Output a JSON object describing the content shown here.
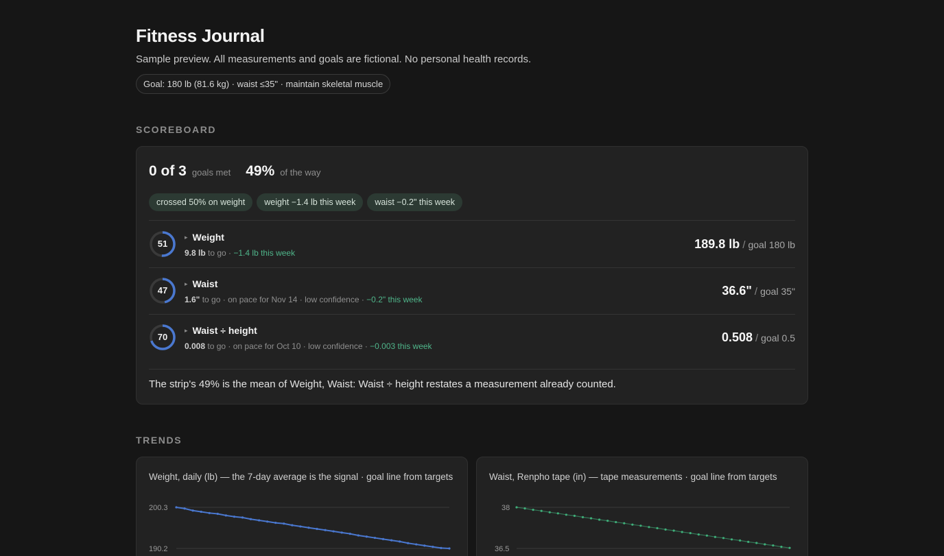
{
  "header": {
    "title": "Fitness Journal",
    "subtitle": "Sample preview. All measurements and goals are fictional. No personal health records.",
    "goal_pill": "Goal: 180 lb (81.6 kg) · waist ≤35\" · maintain skeletal muscle"
  },
  "scoreboard": {
    "heading": "SCOREBOARD",
    "goals_met": "0 of 3",
    "goals_met_label": "goals met",
    "percent": "49%",
    "percent_label": "of the way",
    "chips": [
      "crossed 50% on weight",
      "weight −1.4 lb this week",
      "waist −0.2\" this week"
    ],
    "rows": [
      {
        "progress": 51,
        "progress_label": "51",
        "label": "Weight",
        "remaining": "9.8 lb",
        "detail_mid": " to go · ",
        "change": "−1.4 lb this week",
        "value": "189.8 lb",
        "sep": "/",
        "goal": "goal 180 lb"
      },
      {
        "progress": 47,
        "progress_label": "47",
        "label": "Waist",
        "remaining": "1.6\"",
        "detail_mid": " to go · on pace for Nov 14 · low confidence · ",
        "change": "−0.2\" this week",
        "value": "36.6\"",
        "sep": "/",
        "goal": "goal 35\""
      },
      {
        "progress": 70,
        "progress_label": "70",
        "label": "Waist ÷ height",
        "remaining": "0.008",
        "detail_mid": " to go · on pace for Oct 10 · low confidence · ",
        "change": "−0.003 this week",
        "value": "0.508",
        "sep": "/",
        "goal": "goal 0.5"
      }
    ],
    "footnote": "The strip's 49% is the mean of Weight, Waist: Waist ÷ height restates a measurement already counted."
  },
  "trends": {
    "heading": "TRENDS",
    "colors": {
      "weight": "#4a78d0",
      "waist": "#3fae79"
    },
    "charts": [
      {
        "title": "Weight, daily (lb) — the 7-day average is the signal · goal line from targets",
        "tick_labels": [
          "200.3",
          "190.2"
        ]
      },
      {
        "title": "Waist, Renpho tape (in) — tape measurements · goal line from targets",
        "tick_labels": [
          "38",
          "36.5"
        ]
      }
    ]
  },
  "chart_data": [
    {
      "type": "line",
      "title": "Weight, daily (lb) — the 7-day average is the signal · goal line from targets",
      "y_ticks": [
        200.3,
        190.2
      ],
      "series": [
        {
          "values": [
            200.3,
            200.0,
            199.5,
            199.2,
            198.9,
            198.7,
            198.3,
            198.0,
            197.8,
            197.4,
            197.1,
            196.8,
            196.5,
            196.3,
            195.9,
            195.6,
            195.3,
            195.0,
            194.7,
            194.4,
            194.1,
            193.8,
            193.4,
            193.1,
            192.8,
            192.5,
            192.2,
            191.9,
            191.5,
            191.2,
            190.9,
            190.6,
            190.3,
            190.2
          ]
        }
      ]
    },
    {
      "type": "line",
      "title": "Waist, Renpho tape (in) — tape measurements · goal line from targets",
      "y_ticks": [
        38,
        36.5
      ],
      "series": [
        {
          "values": [
            38.0,
            37.96,
            37.91,
            37.87,
            37.82,
            37.78,
            37.73,
            37.69,
            37.64,
            37.6,
            37.55,
            37.51,
            37.46,
            37.42,
            37.37,
            37.33,
            37.28,
            37.24,
            37.19,
            37.15,
            37.1,
            37.06,
            37.01,
            36.97,
            36.92,
            36.88,
            36.83,
            36.79,
            36.74,
            36.7,
            36.65,
            36.61,
            36.56,
            36.52
          ]
        }
      ]
    }
  ]
}
